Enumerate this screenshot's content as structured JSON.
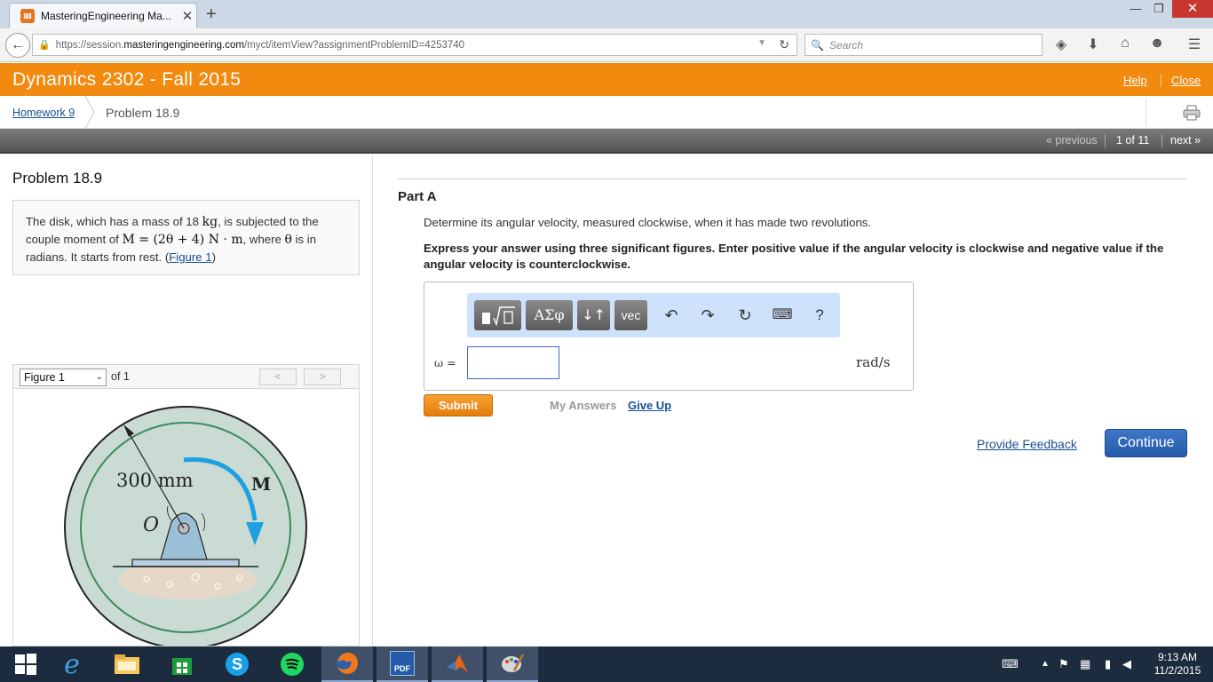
{
  "browser": {
    "tab_title": "MasteringEngineering Ma...",
    "url_prefix": "https://session.",
    "url_domain": "masteringengineering.com",
    "url_path": "/myct/itemView?assignmentProblemID=4253740",
    "search_placeholder": "Search"
  },
  "header": {
    "course_title": "Dynamics 2302 - Fall 2015",
    "help_label": "Help",
    "close_label": "Close"
  },
  "breadcrumb": {
    "homework_label": "Homework 9",
    "problem_label": "Problem 18.9"
  },
  "pager": {
    "previous_label": "« previous",
    "count_label": "1 of 11",
    "next_label": "next »"
  },
  "problem": {
    "title": "Problem 18.9",
    "text_1": "The disk, which has a mass of 18 ",
    "unit_kg": "kg",
    "text_2": ", is subjected to the couple moment of ",
    "formula": "M = (2θ + 4) N · m",
    "text_3": ", where ",
    "theta": "θ",
    "text_4": " is in radians. It starts from rest. (",
    "figure_link": "Figure 1",
    "text_5": ")"
  },
  "figure": {
    "selected": "Figure 1",
    "of_label": "of 1",
    "prev_label": "<",
    "next_label": ">",
    "radius_label": "300 mm",
    "moment_label": "M",
    "origin_label": "O"
  },
  "part": {
    "title": "Part A",
    "question": "Determine its angular velocity, measured clockwise, when it has made two revolutions.",
    "instruction": "Express your answer using three significant figures. Enter positive value if the angular velocity is clockwise and negative value if the angular velocity is counterclockwise.",
    "toolbar": {
      "greek_label": "ΑΣφ",
      "subsup_label": "↓↑",
      "vec_label": "vec",
      "help_label": "?"
    },
    "variable_label": "ω =",
    "answer_value": "",
    "unit_label": "rad/s",
    "submit_label": "Submit",
    "my_answers_label": "My Answers",
    "give_up_label": "Give Up"
  },
  "footer": {
    "feedback_label": "Provide Feedback",
    "continue_label": "Continue"
  },
  "taskbar": {
    "time": "9:13 AM",
    "date": "11/2/2015"
  },
  "colors": {
    "accent_orange": "#f18a0e",
    "link_blue": "#1a4f93",
    "continue_blue": "#2f68b8"
  }
}
